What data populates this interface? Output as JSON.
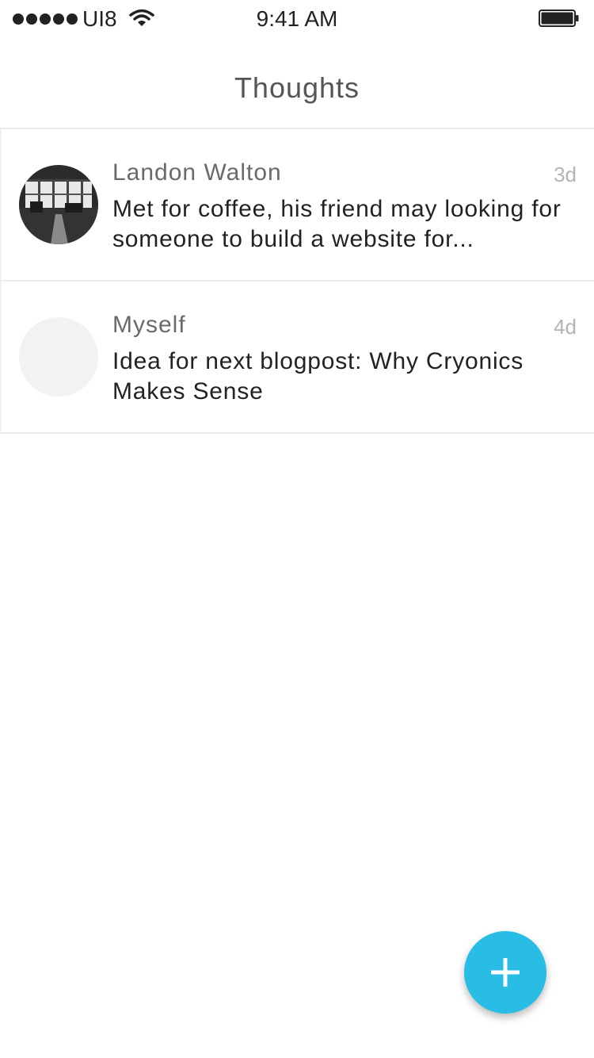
{
  "status_bar": {
    "carrier": "UI8",
    "time": "9:41 AM",
    "icons": [
      "signal-dots-icon",
      "wifi-icon",
      "battery-icon"
    ]
  },
  "header": {
    "title": "Thoughts"
  },
  "thoughts": [
    {
      "name": "Landon Walton",
      "time": "3d",
      "text": "Met for coffee, his friend may looking for someone to build a website for...",
      "avatar": "photo-avatar"
    },
    {
      "name": "Myself",
      "time": "4d",
      "text": "Idea for next blogpost: Why Cryonics Makes Sense",
      "avatar": "blank-avatar"
    }
  ],
  "fab": {
    "icon": "plus-icon",
    "color": "#29bde6"
  }
}
